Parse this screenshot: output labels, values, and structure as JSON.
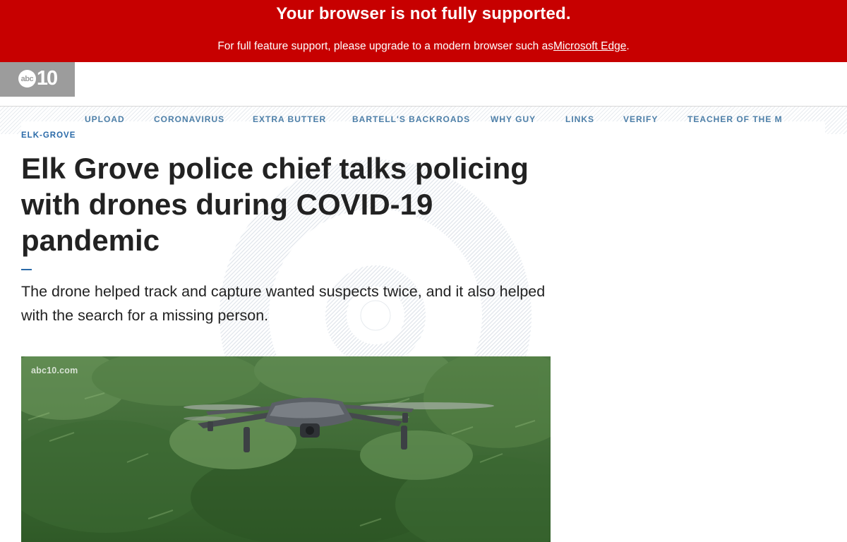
{
  "banner": {
    "title": "Your browser is not fully supported.",
    "message": "For full feature support, please upgrade to a modern browser such as",
    "link": "Microsoft Edge",
    "end": "."
  },
  "logo": {
    "abc": "abc",
    "number": "10"
  },
  "nav": {
    "items": [
      "UPLOAD",
      "CORONAVIRUS",
      "EXTRA BUTTER",
      "BARTELL'S BACKROADS",
      "WHY GUY",
      "LINKS",
      "VERIFY",
      "TEACHER OF THE M"
    ]
  },
  "article": {
    "category": "ELK-GROVE",
    "headline": "Elk Grove police chief talks policing with drones during COVID-19 pandemic",
    "dek": "The drone helped track and capture wanted suspects twice, and it also helped with the search for a missing person."
  },
  "video": {
    "watermark": "abc10.com"
  },
  "colors": {
    "banner_red": "#c70000",
    "logo_gray": "#9c9c9c",
    "nav_blue": "#4d7fa8",
    "accent_blue": "#2a6aa8",
    "foliage": "#3d6a32"
  }
}
